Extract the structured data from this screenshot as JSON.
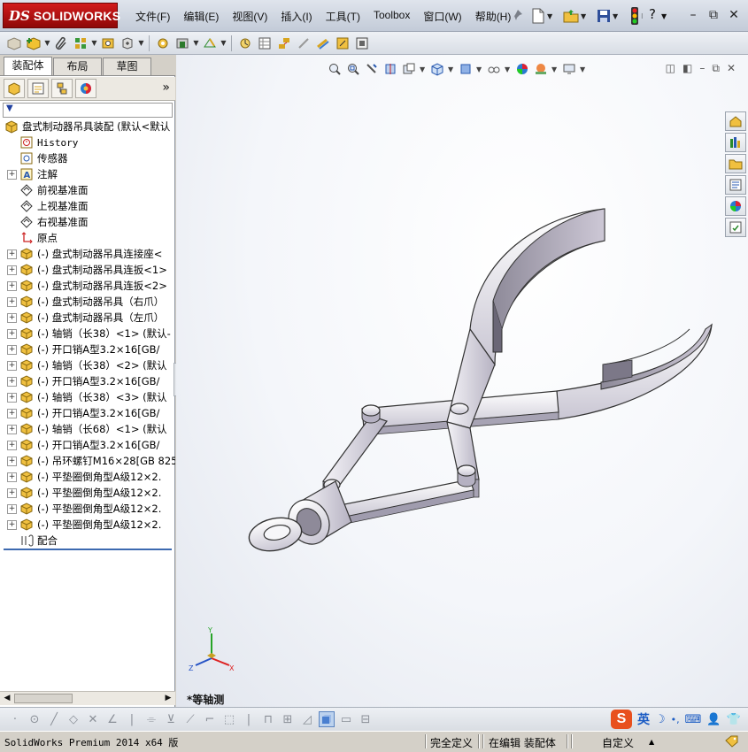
{
  "app": {
    "logo_ds": "DS",
    "logo_word": "SOLIDWORKS"
  },
  "menu": [
    "文件(F)",
    "编辑(E)",
    "视图(V)",
    "插入(I)",
    "工具(T)",
    "Toolbox",
    "窗口(W)",
    "帮助(H)"
  ],
  "help_symbol": "?",
  "panel_tabs": [
    "装配体",
    "布局",
    "草图"
  ],
  "more_symbol": "»",
  "tree": [
    {
      "label": "盘式制动器吊具装配  (默认<默认",
      "icon": "assembly-icon",
      "expand": "",
      "indent": 0
    },
    {
      "label": "History",
      "icon": "history-icon",
      "expand": "",
      "indent": 1,
      "mono": true
    },
    {
      "label": "传感器",
      "icon": "sensor-icon",
      "expand": "",
      "indent": 1
    },
    {
      "label": "注解",
      "icon": "annotation-icon",
      "expand": "+",
      "indent": 1
    },
    {
      "label": "前视基准面",
      "icon": "plane-icon",
      "expand": "",
      "indent": 1
    },
    {
      "label": "上视基准面",
      "icon": "plane-icon",
      "expand": "",
      "indent": 1
    },
    {
      "label": "右视基准面",
      "icon": "plane-icon",
      "expand": "",
      "indent": 1
    },
    {
      "label": "原点",
      "icon": "origin-icon",
      "expand": "",
      "indent": 1
    },
    {
      "label": "(-) 盘式制动器吊具连接座<",
      "icon": "part-icon",
      "expand": "+",
      "indent": 1
    },
    {
      "label": "(-) 盘式制动器吊具连扳<1>",
      "icon": "part-icon",
      "expand": "+",
      "indent": 1
    },
    {
      "label": "(-) 盘式制动器吊具连扳<2>",
      "icon": "part-icon",
      "expand": "+",
      "indent": 1
    },
    {
      "label": "(-) 盘式制动器吊具（右爪）",
      "icon": "part-icon",
      "expand": "+",
      "indent": 1
    },
    {
      "label": "(-) 盘式制动器吊具（左爪）",
      "icon": "part-icon",
      "expand": "+",
      "indent": 1
    },
    {
      "label": "(-) 轴销（长38）<1> (默认-",
      "icon": "part-icon",
      "expand": "+",
      "indent": 1
    },
    {
      "label": "(-) 开口销A型3.2×16[GB/",
      "icon": "part-icon",
      "expand": "+",
      "indent": 1
    },
    {
      "label": "(-) 轴销（长38）<2> (默认",
      "icon": "part-icon",
      "expand": "+",
      "indent": 1
    },
    {
      "label": "(-) 开口销A型3.2×16[GB/",
      "icon": "part-icon",
      "expand": "+",
      "indent": 1
    },
    {
      "label": "(-) 轴销（长38）<3> (默认",
      "icon": "part-icon",
      "expand": "+",
      "indent": 1
    },
    {
      "label": "(-) 开口销A型3.2×16[GB/",
      "icon": "part-icon",
      "expand": "+",
      "indent": 1
    },
    {
      "label": "(-) 轴销（长68）<1> (默认",
      "icon": "part-icon",
      "expand": "+",
      "indent": 1
    },
    {
      "label": "(-) 开口销A型3.2×16[GB/",
      "icon": "part-icon",
      "expand": "+",
      "indent": 1
    },
    {
      "label": "(-) 吊环螺钉M16×28[GB 825",
      "icon": "part-icon",
      "expand": "+",
      "indent": 1
    },
    {
      "label": "(-) 平垫圈倒角型A级12×2.",
      "icon": "part-icon",
      "expand": "+",
      "indent": 1
    },
    {
      "label": "(-) 平垫圈倒角型A级12×2.",
      "icon": "part-icon",
      "expand": "+",
      "indent": 1
    },
    {
      "label": "(-) 平垫圈倒角型A级12×2.",
      "icon": "part-icon",
      "expand": "+",
      "indent": 1
    },
    {
      "label": "(-) 平垫圈倒角型A级12×2.",
      "icon": "part-icon",
      "expand": "+",
      "indent": 1
    },
    {
      "label": "配合",
      "icon": "mates-icon",
      "expand": "",
      "indent": 1
    }
  ],
  "viewport": {
    "view_name": "*等轴测",
    "triad": {
      "x": "X",
      "y": "Y",
      "z": "Z"
    }
  },
  "ime": {
    "logo": "S",
    "mode": "英"
  },
  "status": {
    "product": "SolidWorks Premium 2014 x64 版",
    "definition": "完全定义",
    "editing": "在编辑 装配体",
    "custom": "自定义"
  },
  "colors": {
    "brand_red": "#c41414",
    "tree_accent": "#3d6ab0",
    "ime_orange": "#e8501e"
  }
}
